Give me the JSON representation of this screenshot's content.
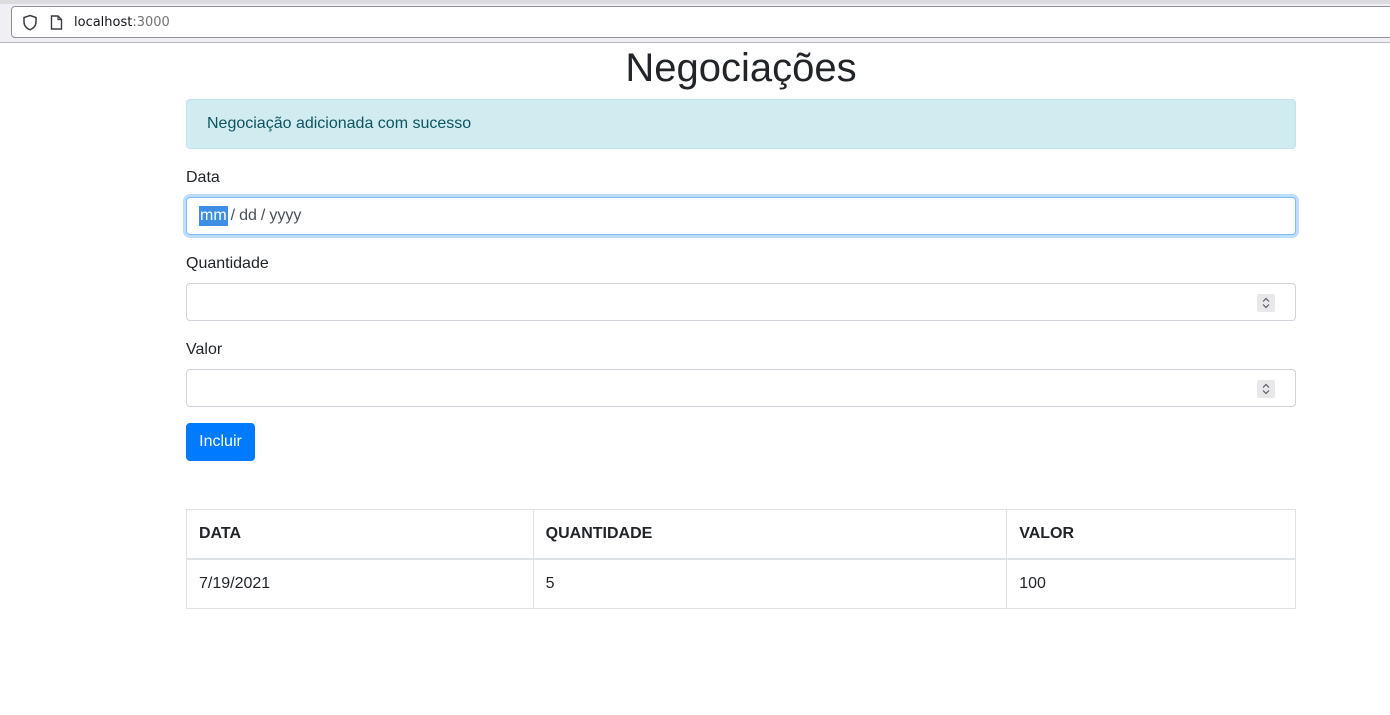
{
  "browser": {
    "url_host": "localhost",
    "url_port": ":3000"
  },
  "page": {
    "title": "Negociações",
    "alert_message": "Negociação adicionada com sucesso"
  },
  "form": {
    "data_label": "Data",
    "date_month_placeholder": "mm",
    "date_day_placeholder": "dd",
    "date_year_placeholder": "yyyy",
    "date_separator": "/",
    "quantidade_label": "Quantidade",
    "quantidade_value": "",
    "valor_label": "Valor",
    "valor_value": "",
    "submit_label": "Incluir"
  },
  "table": {
    "headers": [
      "DATA",
      "QUANTIDADE",
      "VALOR"
    ],
    "rows": [
      [
        "7/19/2021",
        "5",
        "100"
      ]
    ]
  },
  "colors": {
    "primary": "#007bff",
    "alert_bg": "#d1ecf1",
    "alert_text": "#0c5460",
    "selection": "#3d8ee4"
  }
}
